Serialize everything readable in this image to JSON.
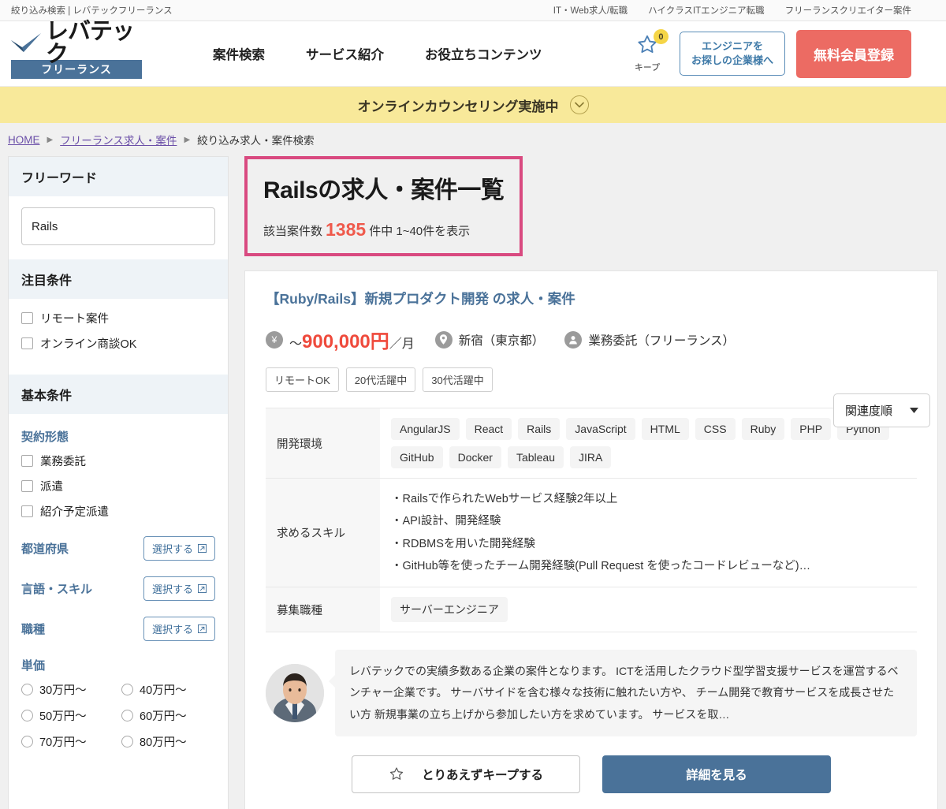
{
  "topbar": {
    "left": "絞り込み検索 | レバテックフリーランス",
    "links": [
      "IT・Web求人/転職",
      "ハイクラスITエンジニア転職",
      "フリーランスクリエイター案件"
    ]
  },
  "header": {
    "logo_word": "レバテック",
    "logo_banner": "フリーランス",
    "nav": [
      "案件検索",
      "サービス紹介",
      "お役立ちコンテンツ"
    ],
    "keep_label": "キープ",
    "keep_count": "0",
    "company_button": "エンジニアを\nお探しの企業様へ",
    "company_button_line1": "エンジニアを",
    "company_button_line2": "お探しの企業様へ",
    "register_button": "無料会員登録"
  },
  "banner": {
    "text": "オンラインカウンセリング実施中"
  },
  "breadcrumb": {
    "home": "HOME",
    "parent": "フリーランス求人・案件",
    "current": "絞り込み求人・案件検索"
  },
  "sidebar": {
    "freeword": {
      "heading": "フリーワード",
      "value": "Rails"
    },
    "featured": {
      "heading": "注目条件",
      "items": [
        "リモート案件",
        "オンライン商談OK"
      ]
    },
    "basic": {
      "heading": "基本条件",
      "contract": {
        "label": "契約形態",
        "items": [
          "業務委託",
          "派遣",
          "紹介予定派遣"
        ]
      },
      "selectors": [
        {
          "label": "都道府県",
          "button": "選択する"
        },
        {
          "label": "言語・スキル",
          "button": "選択する"
        },
        {
          "label": "職種",
          "button": "選択する"
        }
      ],
      "price": {
        "label": "単価",
        "options": [
          "30万円〜",
          "40万円〜",
          "50万円〜",
          "60万円〜",
          "70万円〜",
          "80万円〜"
        ]
      }
    }
  },
  "results": {
    "title": "Railsの求人・案件一覧",
    "count_prefix": "該当案件数",
    "count": "1385",
    "count_suffix": "件中 1~40件を表示",
    "sort_value": "関連度順"
  },
  "job": {
    "title": "【Ruby/Rails】新規プロダクト開発 の求人・案件",
    "salary_prefix": "〜",
    "salary": "900,000円",
    "salary_suffix": "／月",
    "location": "新宿（東京都）",
    "contract": "業務委託（フリーランス）",
    "tags": [
      "リモートOK",
      "20代活躍中",
      "30代活躍中"
    ],
    "table": [
      {
        "header": "開発環境",
        "chips": [
          "AngularJS",
          "React",
          "Rails",
          "JavaScript",
          "HTML",
          "CSS",
          "Ruby",
          "PHP",
          "Python",
          "GitHub",
          "Docker",
          "Tableau",
          "JIRA"
        ]
      },
      {
        "header": "求めるスキル",
        "bullets": [
          "・Railsで作られたWebサービス経験2年以上",
          "・API設計、開発経験",
          "・RDBMSを用いた開発経験",
          "・GitHub等を使ったチーム開発経験(Pull Request を使ったコードレビューなど)…"
        ]
      },
      {
        "header": "募集職種",
        "chips": [
          "サーバーエンジニア"
        ]
      }
    ],
    "description": "レバテックでの実績多数ある企業の案件となります。 ICTを活用したクラウド型学習支援サービスを運営するベンチャー企業です。 サーバサイドを含む様々な技術に触れたい方や、 チーム開発で教育サービスを成長させたい方 新規事業の立ち上げから参加したい方を求めています。 サービスを取…",
    "keep_button": "とりあえずキープする",
    "detail_button": "詳細を見る"
  },
  "colors": {
    "accent_red": "#ec6b63",
    "price_red": "#ef4a3c",
    "brand_blue": "#4a7299",
    "highlight_pink": "#d94a80",
    "banner_yellow": "#f8e99a"
  }
}
